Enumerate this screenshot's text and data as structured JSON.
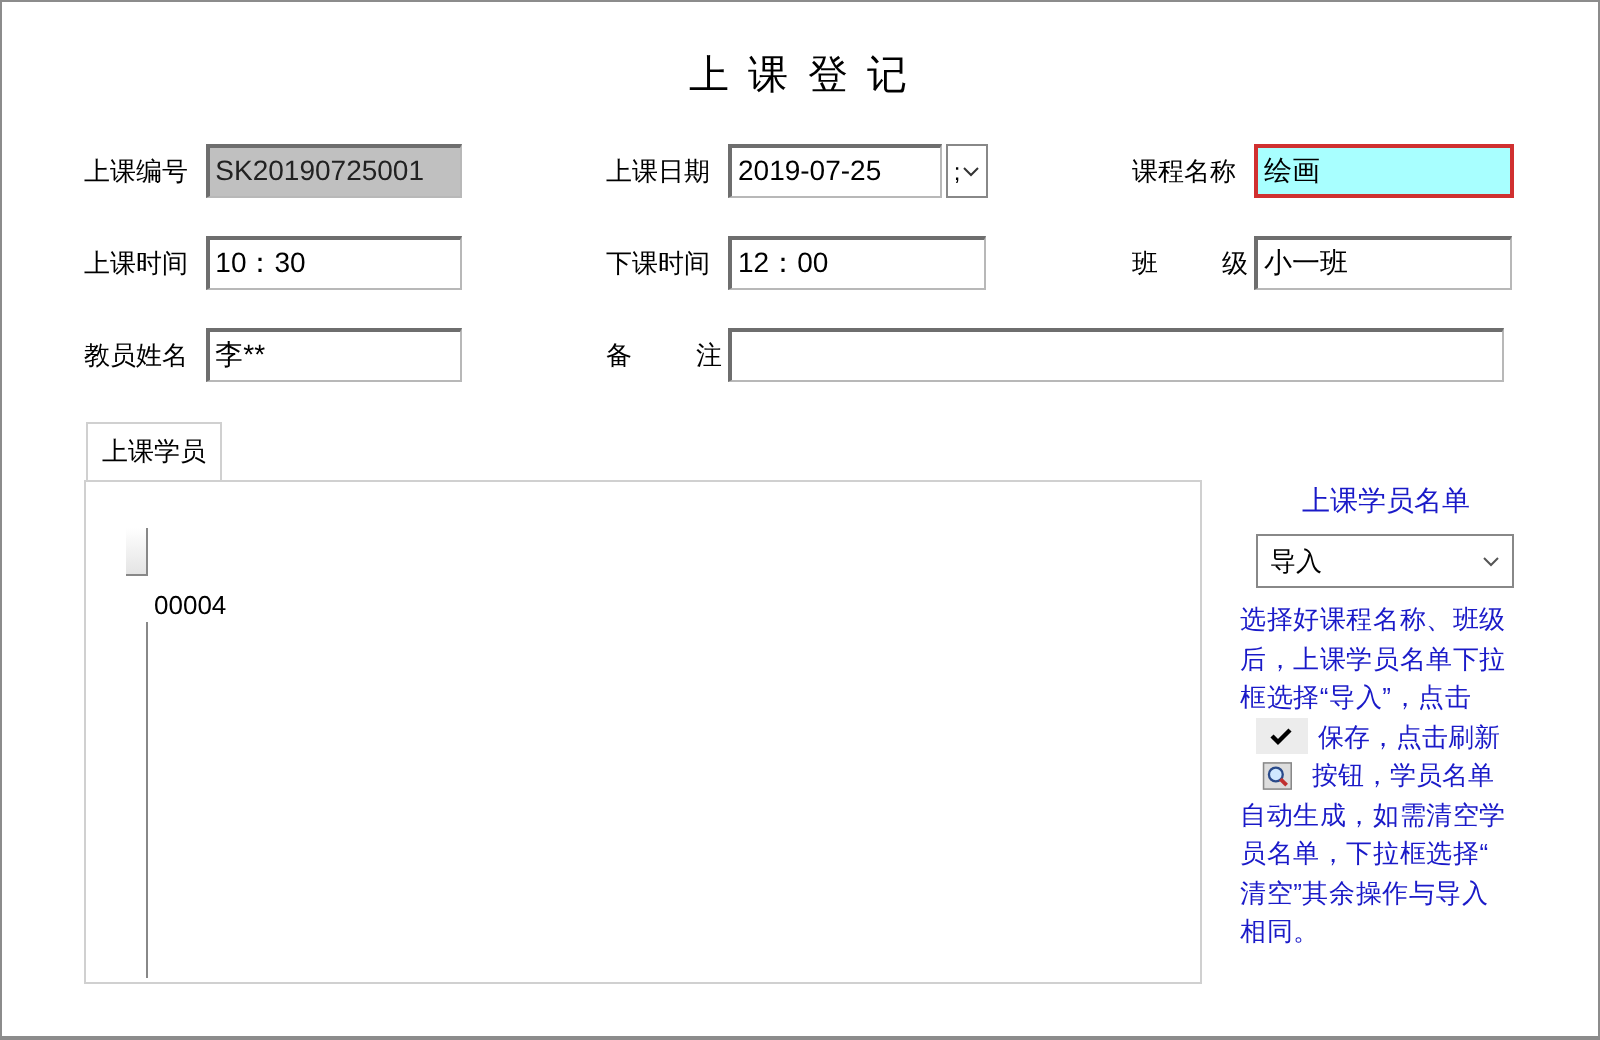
{
  "title": "上 课 登 记",
  "fields": [
    {
      "label": "上课编号",
      "value": "SK20190725001",
      "kind": "readonly"
    },
    {
      "label": "上课日期",
      "value": "2019-07-25",
      "kind": "date",
      "button_text": ";"
    },
    {
      "label": "课程名称",
      "value": "绘画",
      "kind": "highlight"
    },
    {
      "label": "上课时间",
      "value": "10：30",
      "kind": "text"
    },
    {
      "label": "下课时间",
      "value": "12：00",
      "kind": "text"
    },
    {
      "label": "班 级",
      "value": "小一班",
      "kind": "text"
    },
    {
      "label": "教员姓名",
      "value": "李**",
      "kind": "text"
    },
    {
      "label": "备 注",
      "kind": "wide"
    }
  ],
  "tabs": [
    {
      "label": "上课学员",
      "selected": true
    }
  ],
  "grid": {
    "cell": "00004"
  },
  "side": {
    "title": "上课学员名单",
    "select": "导入",
    "instructions": [
      {
        "kind": "text",
        "text": "选择好课程名称、班级"
      },
      {
        "kind": "text",
        "text": "后，上课学员名单下拉"
      },
      {
        "kind": "text",
        "text": "框选择“导入”，点击"
      },
      {
        "kind": "check",
        "text": "保存，点击刷新"
      },
      {
        "kind": "magnifier",
        "text": "按钮，学员名单"
      },
      {
        "kind": "text",
        "text": "自动生成，如需清空学"
      },
      {
        "kind": "text",
        "text": "员名单，下拉框选择“"
      },
      {
        "kind": "text",
        "text": "清空”其余操作与导入"
      },
      {
        "kind": "text",
        "text": "相同。"
      }
    ]
  }
}
